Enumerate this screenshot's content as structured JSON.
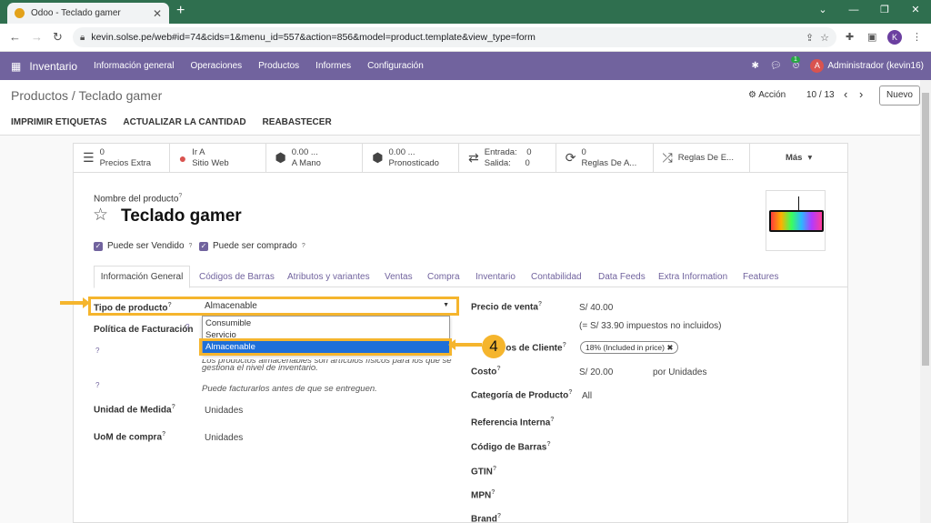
{
  "browser": {
    "tab_title": "Odoo - Teclado gamer",
    "url": "kevin.solse.pe/web#id=74&cids=1&menu_id=557&action=856&model=product.template&view_type=form",
    "profile_initial": "K"
  },
  "navbar": {
    "app_name": "Inventario",
    "menu": [
      "Información general",
      "Operaciones",
      "Productos",
      "Informes",
      "Configuración"
    ],
    "activity_count": "1",
    "user_initial": "A",
    "user_name": "Administrador (kevin16)"
  },
  "control_panel": {
    "breadcrumb": "Productos / Teclado gamer",
    "action_label": "Acción",
    "pager": "10 / 13",
    "new_button": "Nuevo",
    "status_buttons": [
      "IMPRIMIR ETIQUETAS",
      "ACTUALIZAR LA CANTIDAD",
      "REABASTECER"
    ]
  },
  "smart_buttons": {
    "precios_value": "0",
    "precios_label": "Precios Extra",
    "web_line1": "Ir A",
    "web_line2": "Sitio Web",
    "amano_value": "0.00 ...",
    "amano_label": "A Mano",
    "pron_value": "0.00 ...",
    "pron_label": "Pronosticado",
    "entrada_label": "Entrada:",
    "entrada_value": "0",
    "salida_label": "Salida:",
    "salida_value": "0",
    "reglas_value": "0",
    "reglas_label": "Reglas De A...",
    "reglas_e_label": "Reglas De E...",
    "mas_label": "Más"
  },
  "form": {
    "name_label": "Nombre del producto",
    "product_name": "Teclado gamer",
    "can_be_sold": "Puede ser Vendido",
    "can_be_purchased": "Puede ser comprado",
    "tabs": [
      "Información General",
      "Códigos de Barras",
      "Atributos y variantes",
      "Ventas",
      "Compra",
      "Inventario",
      "Contabilidad",
      "Data Feeds",
      "Extra Information",
      "Features"
    ],
    "tipo_label": "Tipo de producto",
    "tipo_value": "Almacenable",
    "dropdown_options": [
      "Consumible",
      "Servicio",
      "Almacenable"
    ],
    "politica_label": "Política de Facturación",
    "help_stock": "Los productos almacenables son artículos físicos para los que se",
    "help_stock2": "gestiona el nivel de inventario.",
    "help_invoice": "Puede facturarlos antes de que se entreguen.",
    "uom_label": "Unidad de Medida",
    "uom_value": "Unidades",
    "uom_po_label": "UoM de compra",
    "uom_po_value": "Unidades",
    "precio_label": "Precio de venta",
    "precio_value": "S/ 40.00",
    "precio_note": "(= S/ 33.90 impuestos no incluidos)",
    "impuestos_label": "Impuestos de Cliente",
    "impuesto_tag": "18% (Included in price)",
    "costo_label": "Costo",
    "costo_value": "S/ 20.00",
    "costo_unit": "por Unidades",
    "categoria_label": "Categoría de Producto",
    "categoria_value": "All",
    "ref_label": "Referencia Interna",
    "barcode_label": "Código de Barras",
    "gtin_label": "GTIN",
    "mpn_label": "MPN",
    "brand_label": "Brand",
    "qmark": "?"
  },
  "annotation": {
    "step_number": "4"
  },
  "colors": {
    "odoo_purple": "#71639e",
    "highlight": "#f5b52d",
    "selected_option": "#1e6fd9"
  }
}
